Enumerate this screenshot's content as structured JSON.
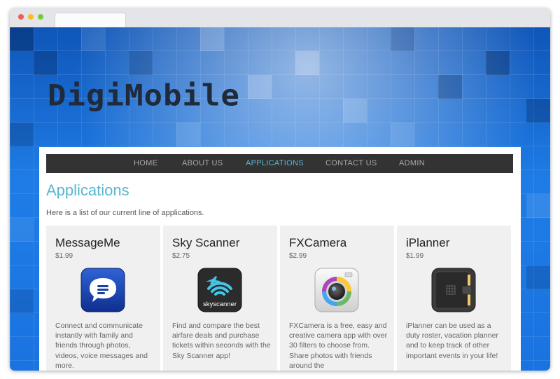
{
  "site": {
    "logo": "DigiMobile"
  },
  "nav": {
    "items": [
      {
        "label": "HOME",
        "active": false
      },
      {
        "label": "ABOUT US",
        "active": false
      },
      {
        "label": "APPLICATIONS",
        "active": true
      },
      {
        "label": "CONTACT US",
        "active": false
      },
      {
        "label": "ADMIN",
        "active": false
      }
    ]
  },
  "main": {
    "title": "Applications",
    "intro": "Here is a list of our current line of applications."
  },
  "apps": [
    {
      "name": "MessageMe",
      "price": "$1.99",
      "icon": "message-bubble-icon",
      "description": "Connect and communicate instantly with family and friends through photos, videos, voice messages and more."
    },
    {
      "name": "Sky Scanner",
      "price": "$2.75",
      "icon": "skyscanner-logo-icon",
      "icon_text": "skyscanner",
      "description": "Find and compare the best airfare deals and purchase tickets within seconds with the Sky Scanner app!"
    },
    {
      "name": "FXCamera",
      "price": "$2.99",
      "icon": "camera-lens-icon",
      "description": "FXCamera is a free, easy and creative camera app with over 30 filters to choose from. Share photos with friends around the"
    },
    {
      "name": "iPlanner",
      "price": "$1.99",
      "icon": "planner-book-icon",
      "description": "iPlanner can be used as a duty roster, vacation planner and to keep track of other important events in your life!"
    }
  ],
  "colors": {
    "accent": "#58b6cf",
    "nav_bg": "#333333",
    "background_blue": "#1a73e0"
  }
}
